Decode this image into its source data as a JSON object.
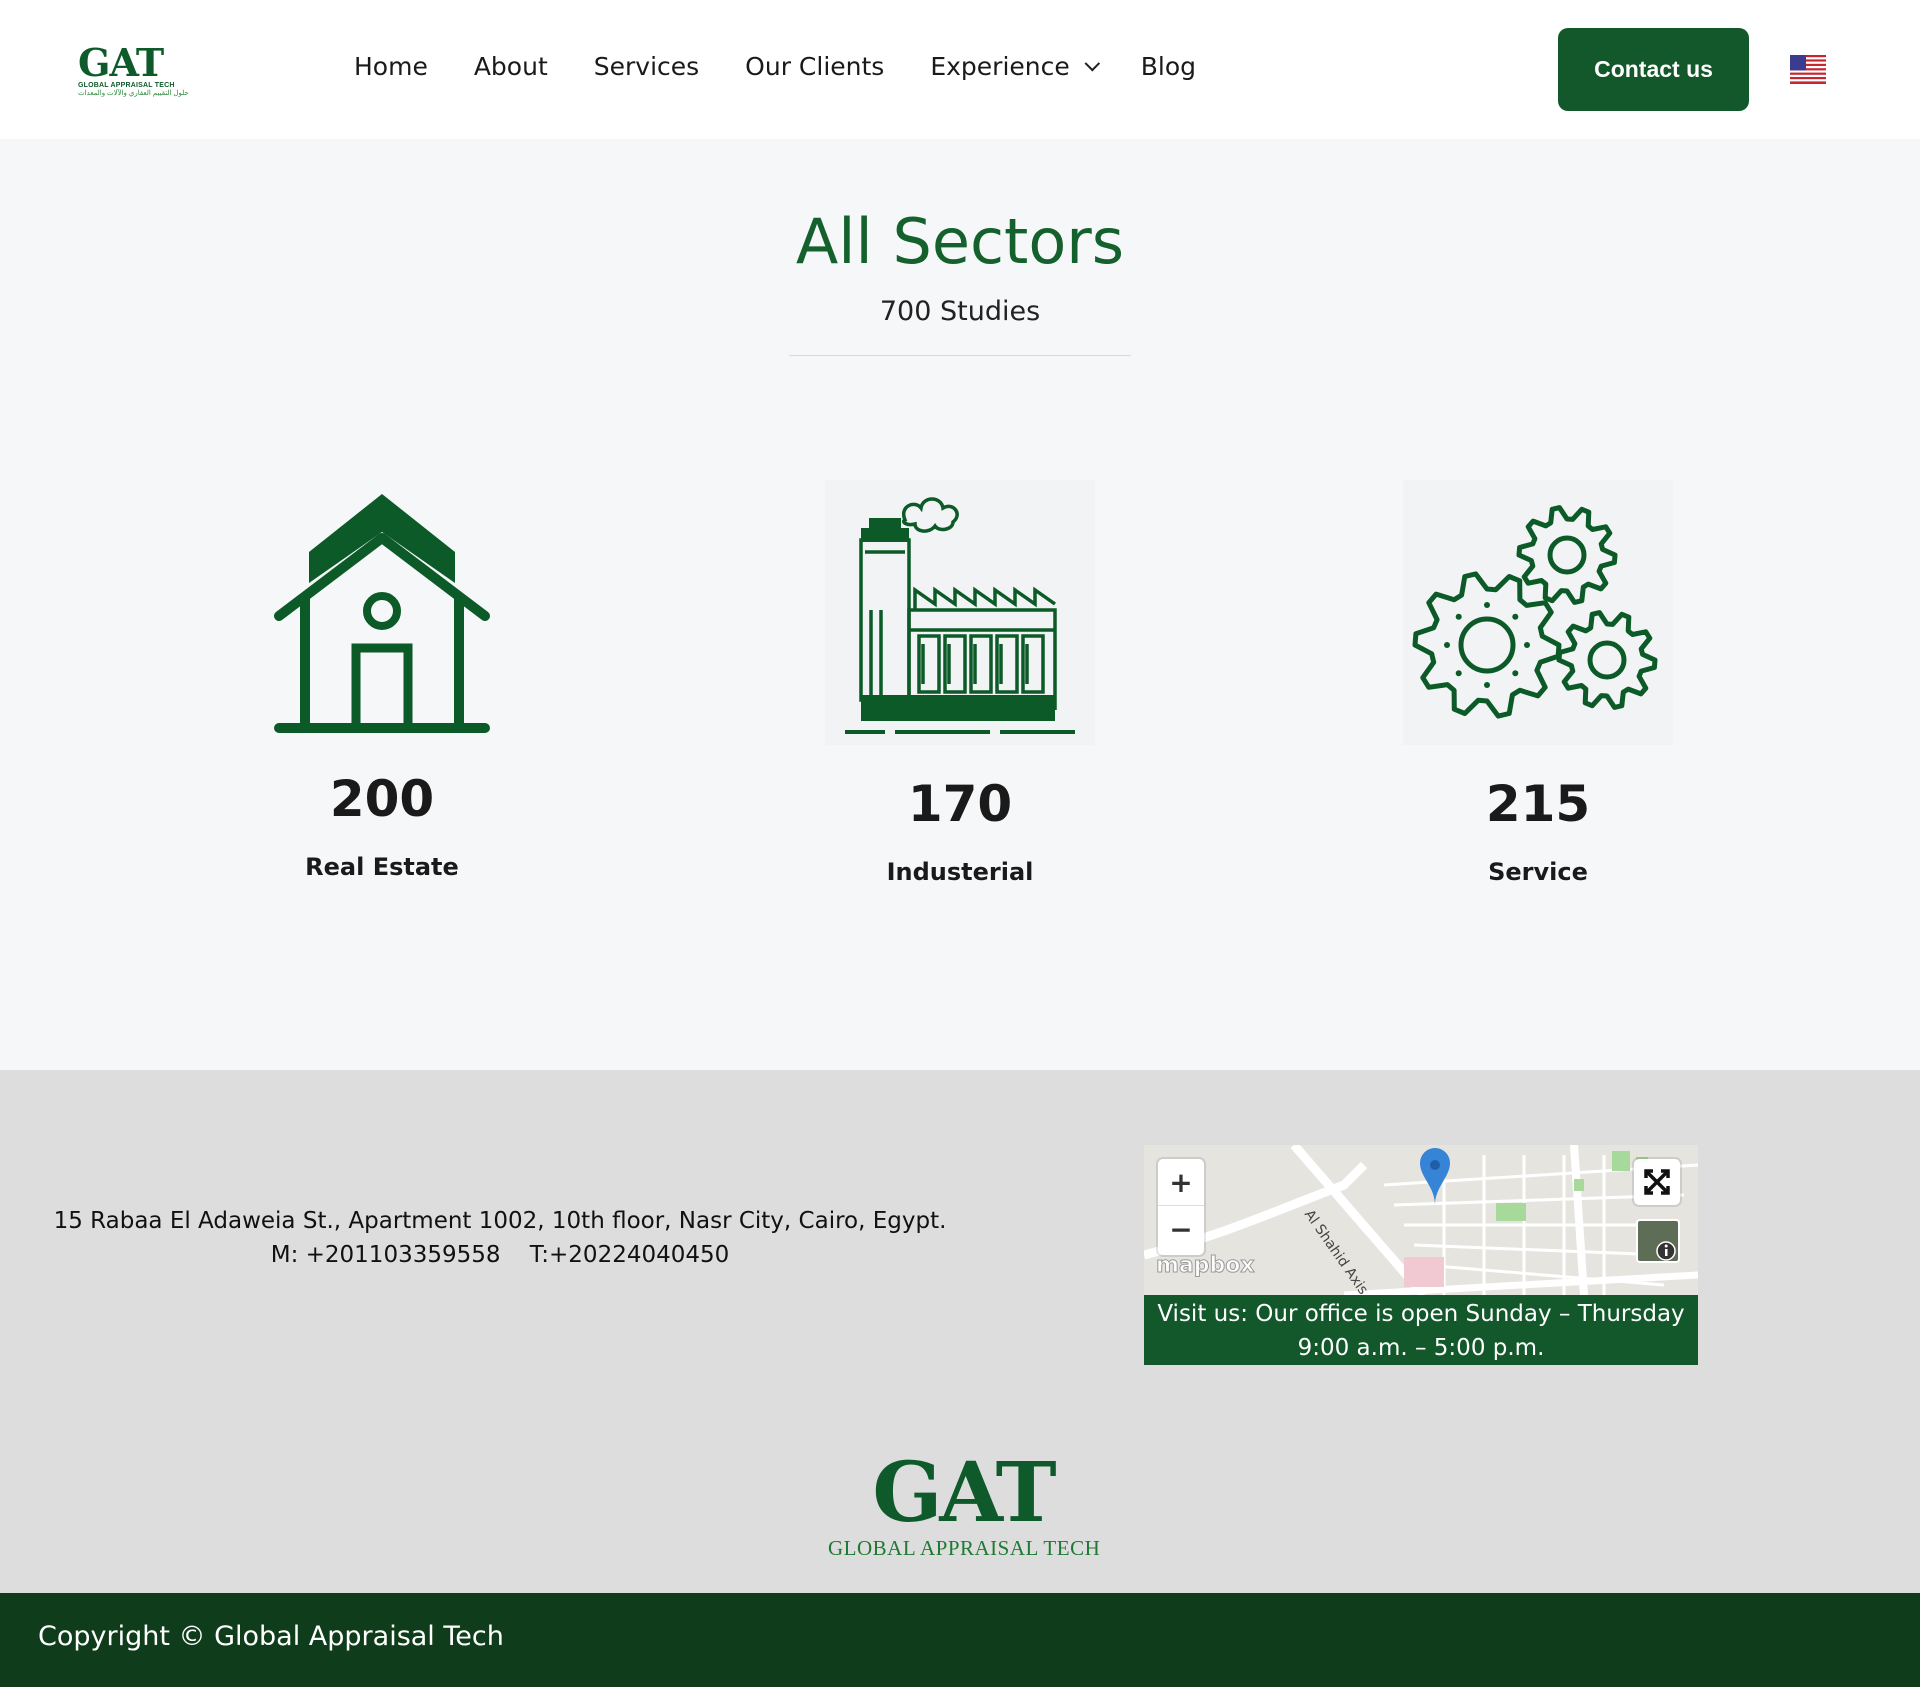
{
  "header": {
    "logo": {
      "word": "GAT",
      "sub": "GLOBAL APPRAISAL TECH",
      "arabic": "حلول التقييم العقاري والآلات والمعدات"
    },
    "nav": [
      {
        "label": "Home"
      },
      {
        "label": "About"
      },
      {
        "label": "Services"
      },
      {
        "label": "Our Clients"
      },
      {
        "label": "Experience",
        "has_dropdown": true
      },
      {
        "label": "Blog"
      }
    ],
    "contact_label": "Contact us",
    "language_icon": "us-flag-icon"
  },
  "sectors": {
    "title": "All Sectors",
    "subtitle": "700 Studies",
    "items": [
      {
        "number": "200",
        "label": "Real Estate",
        "icon": "house-icon"
      },
      {
        "number": "170",
        "label": "Industerial",
        "icon": "factory-icon"
      },
      {
        "number": "215",
        "label": "Service",
        "icon": "gears-icon"
      }
    ]
  },
  "footer": {
    "address_line1": "15 Rabaa El Adaweia St., Apartment 1002, 10th floor, Nasr City, Cairo, Egypt.",
    "address_line2": "M: +201103359558    T:+20224040450",
    "map": {
      "zoom_in": "+",
      "zoom_out": "−",
      "street": "Al Shahid Axis",
      "attribution": "mapbox"
    },
    "visit_line1": "Visit us: Our office is open Sunday – Thursday",
    "visit_line2": "9:00 a.m. – 5:00 p.m.",
    "logo_word": "GAT",
    "logo_sub": "GLOBAL APPRAISAL TECH",
    "copyright": "Copyright © Global Appraisal Tech"
  },
  "colors": {
    "brand_green": "#13582b",
    "dark_green": "#0f3d1c",
    "icon_green": "#0b5a27"
  }
}
